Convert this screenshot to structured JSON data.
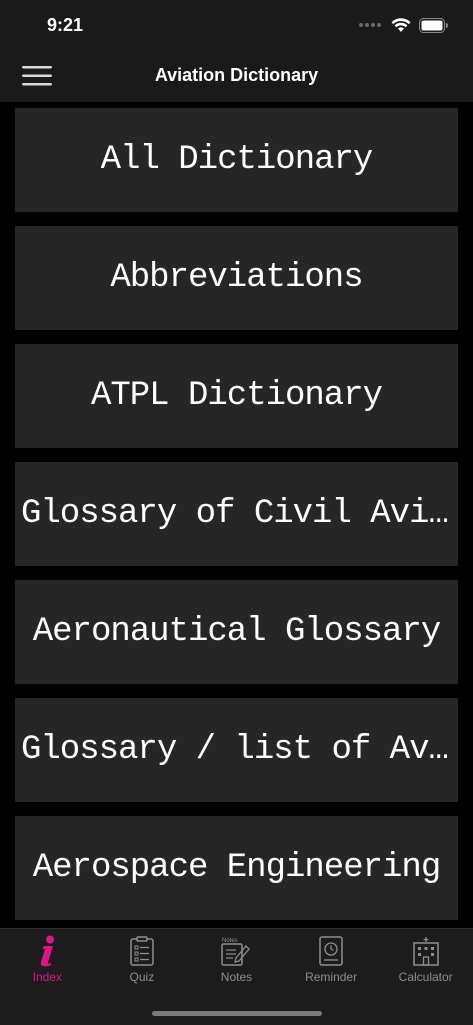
{
  "status_bar": {
    "time": "9:21"
  },
  "header": {
    "title": "Aviation Dictionary"
  },
  "list": {
    "items": [
      {
        "label": "All Dictionary"
      },
      {
        "label": "Abbreviations"
      },
      {
        "label": "ATPL Dictionary"
      },
      {
        "label": "Glossary of Civil Aviati..."
      },
      {
        "label": "Aeronautical Glossary"
      },
      {
        "label": "Glossary / list of Aviati..."
      },
      {
        "label": "Aerospace Engineering"
      }
    ]
  },
  "tab_bar": {
    "active_color": "#e0148a",
    "tabs": [
      {
        "label": "Index",
        "icon": "info-icon",
        "active": true
      },
      {
        "label": "Quiz",
        "icon": "clipboard-icon",
        "active": false
      },
      {
        "label": "Notes",
        "icon": "notes-icon",
        "active": false,
        "icon_caption": "Notes"
      },
      {
        "label": "Reminder",
        "icon": "clock-icon",
        "active": false
      },
      {
        "label": "Calculator",
        "icon": "building-icon",
        "active": false
      }
    ]
  }
}
